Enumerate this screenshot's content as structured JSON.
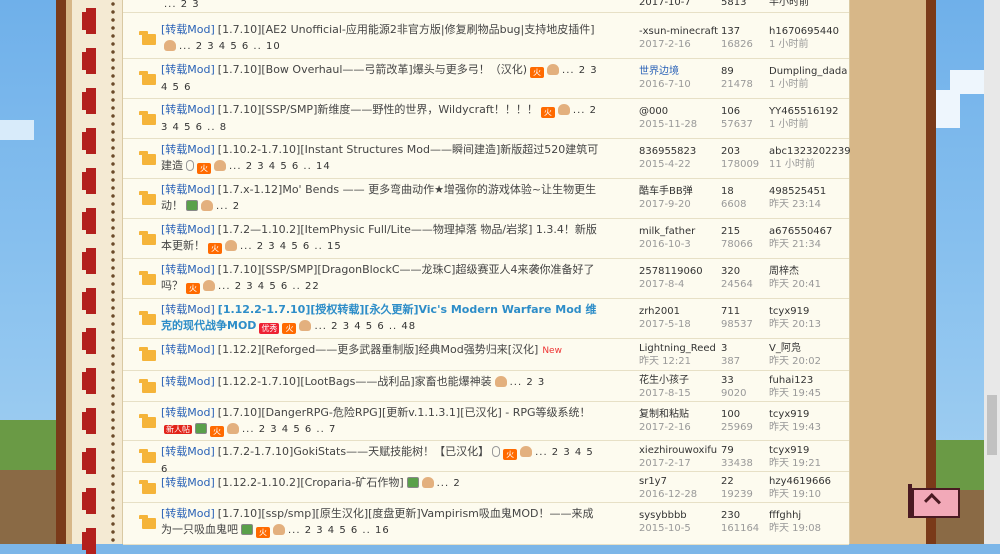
{
  "colors": {
    "frame": "#7a3a19",
    "tan": "#d7b788",
    "panel": "#fdfbef",
    "tag": "#2a62b7",
    "highlight": "#2d8dc8"
  },
  "top_row": {
    "pages": "... 2 3",
    "date": "2017-10-7",
    "views": "5813",
    "last_time": "半小时前"
  },
  "rows": [
    {
      "tag": "[转载Mod]",
      "title": "[1.7.10][AE2 Unofficial-应用能源2非官方版|修复刷物品bug|支持地皮插件]",
      "icons": [
        "thumb"
      ],
      "pages": "... 2 3 4 5 6 .. 10",
      "author": "-xsun-minecraft",
      "date": "2017-2-16",
      "replies": "137",
      "views": "16826",
      "last_user": "h1670695440",
      "last_time": "1 小时前"
    },
    {
      "tag": "[转载Mod]",
      "title": "[1.7.10][Bow Overhaul——弓箭改革]爆头与更多弓！（汉化)",
      "icons": [
        "fire",
        "thumb"
      ],
      "pages": "... 2 3 4 5 6",
      "author": "世界边境",
      "date": "2016-7-10",
      "replies": "89",
      "views": "21478",
      "last_user": "Dumpling_dada",
      "last_time": "1 小时前",
      "author_blue": true
    },
    {
      "tag": "[转载Mod]",
      "title": "[1.7.10][SSP/SMP]新维度——野性的世界，Wildycraft！！！！",
      "icons": [
        "fire",
        "thumb"
      ],
      "pages": "... 2 3 4 5 6 .. 8",
      "author": "@000",
      "date": "2015-11-28",
      "replies": "106",
      "views": "57637",
      "last_user": "YY465516192",
      "last_time": "1 小时前"
    },
    {
      "tag": "[转载Mod]",
      "title": "[1.10.2-1.7.10][Instant Structures Mod——瞬间建造]新版超过520建筑可建造",
      "icons": [
        "clip",
        "fire",
        "thumb"
      ],
      "pages": "... 2 3 4 5 6 .. 14",
      "author": "836955823",
      "date": "2015-4-22",
      "replies": "203",
      "views": "178009",
      "last_user": "abc1323202239",
      "last_time": "11 小时前"
    },
    {
      "tag": "[转载Mod]",
      "title": "[1.7.x-1.12]Mo' Bends —— 更多弯曲动作★增强你的游戏体验~让生物更生动！",
      "icons": [
        "img",
        "thumb"
      ],
      "pages": "... 2",
      "author": "酷车手BB弹",
      "date": "2017-9-20",
      "replies": "18",
      "views": "6608",
      "last_user": "498525451",
      "last_time": "昨天 23:14"
    },
    {
      "tag": "[转载Mod]",
      "title": "[1.7.2—1.10.2][ItemPhysic Full/Lite——物理掉落 物品/岩浆] 1.3.4！新版本更新！",
      "icons": [
        "fire",
        "thumb"
      ],
      "pages": "... 2 3 4 5 6 .. 15",
      "author": "milk_father",
      "date": "2016-10-3",
      "replies": "215",
      "views": "78066",
      "last_user": "a676550467",
      "last_time": "昨天 21:34"
    },
    {
      "tag": "[转载Mod]",
      "title": "[1.7.10][SSP/SMP][DragonBlockC——龙珠C]超级赛亚人4来袭你准备好了吗？",
      "icons": [
        "fire",
        "thumb"
      ],
      "pages": "... 2 3 4 5 6 .. 22",
      "author": "2578119060",
      "date": "2017-8-4",
      "replies": "320",
      "views": "24564",
      "last_user": "周梓杰",
      "last_time": "昨天 20:41"
    },
    {
      "tag": "[转载Mod]",
      "title": "[1.12.2-1.7.10][授权转载][永久更新]Vic's Modern Warfare Mod 维克的现代战争MOD",
      "bold": true,
      "icons": [
        "star",
        "fire",
        "thumb"
      ],
      "star_text": "优秀",
      "pages": "... 2 3 4 5 6 .. 48",
      "author": "zrh2001",
      "date": "2017-5-18",
      "replies": "711",
      "views": "98537",
      "last_user": "tcyx919",
      "last_time": "昨天 20:13"
    },
    {
      "tag": "[转载Mod]",
      "title": "[1.12.2][Reforged——更多武器重制版]经典Mod强势归来[汉化]",
      "icons": [],
      "new_label": "New",
      "pages": "",
      "author": "Lightning_Reed",
      "date": "昨天 12:21",
      "replies": "3",
      "views": "387",
      "last_user": "V_阿凫",
      "last_time": "昨天 20:02"
    },
    {
      "tag": "[转载Mod]",
      "title": "[1.12.2-1.7.10][LootBags——战利品]家畜也能爆神装",
      "icons": [
        "thumb"
      ],
      "pages": "... 2 3",
      "author": "花生小孩子",
      "date": "2017-8-15",
      "replies": "33",
      "views": "9020",
      "last_user": "fuhai123",
      "last_time": "昨天 19:45"
    },
    {
      "tag": "[转载Mod]",
      "title": "[1.7.10][DangerRPG-危险RPG][更新v.1.1.3.1][已汉化] - RPG等级系统！",
      "icons": [
        "img",
        "fire",
        "thumb"
      ],
      "newpost_label": "新人帖",
      "pages": "... 2 3 4 5 6 .. 7",
      "author": "复制和粘贴",
      "date": "2017-2-16",
      "replies": "100",
      "views": "25969",
      "last_user": "tcyx919",
      "last_time": "昨天 19:43"
    },
    {
      "tag": "[转载Mod]",
      "title": "[1.7.2-1.7.10]GokiStats——天赋技能树！【已汉化】",
      "icons": [
        "clip",
        "fire",
        "thumb"
      ],
      "pages": "... 2 3 4 5 6",
      "author": "xiezhirouwoxifu",
      "date": "2017-2-17",
      "replies": "79",
      "views": "33438",
      "last_user": "tcyx919",
      "last_time": "昨天 19:21"
    },
    {
      "tag": "[转载Mod]",
      "title": "[1.12.2-1.10.2][Croparia-矿石作物]",
      "icons": [
        "img",
        "thumb"
      ],
      "pages": "... 2",
      "author": "sr1y7",
      "date": "2016-12-28",
      "replies": "22",
      "views": "19239",
      "last_user": "hzy4619666",
      "last_time": "昨天 19:10"
    },
    {
      "tag": "[转载Mod]",
      "title": "[1.7.10][ssp/smp][原生汉化][度盘更新]Vampirism吸血鬼MOD！——来成为一只吸血鬼吧",
      "icons": [
        "img",
        "fire",
        "thumb"
      ],
      "pages": "... 2 3 4 5 6 .. 16",
      "author": "sysybbbb",
      "date": "2015-10-5",
      "replies": "230",
      "views": "161164",
      "last_user": "fffghhj",
      "last_time": "昨天 19:08"
    }
  ]
}
